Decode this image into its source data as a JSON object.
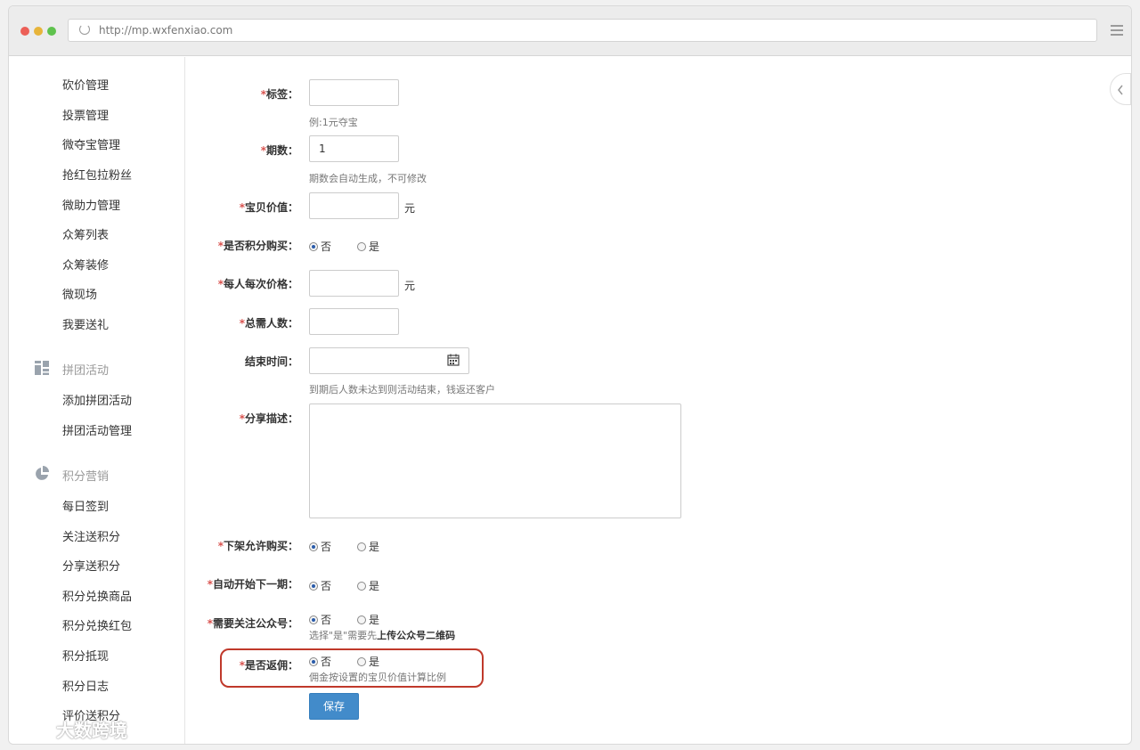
{
  "browser": {
    "url": "http://mp.wxfenxiao.com",
    "colors": {
      "red": "#ec5f57",
      "yellow": "#e7b43a",
      "green": "#5fc24d"
    }
  },
  "sidebar": {
    "items_top": [
      "砍价管理",
      "投票管理",
      "微夺宝管理",
      "抢红包拉粉丝",
      "微助力管理",
      "众筹列表",
      "众筹装修",
      "微现场",
      "我要送礼"
    ],
    "group_pintuan": {
      "label": "拼团活动",
      "icon": "grid-icon",
      "items": [
        "添加拼团活动",
        "拼团活动管理"
      ]
    },
    "group_points": {
      "label": "积分营销",
      "icon": "pie-chart-icon",
      "items": [
        "每日签到",
        "关注送积分",
        "分享送积分",
        "积分兑换商品",
        "积分兑换红包",
        "积分抵现",
        "积分日志",
        "评价送积分"
      ]
    }
  },
  "form": {
    "tag": {
      "label": "标签：",
      "value": "",
      "hint": "例:1元夺宝"
    },
    "period": {
      "label": "期数：",
      "value": "1",
      "hint": "期数会自动生成，不可修改"
    },
    "item_value": {
      "label": "宝贝价值：",
      "value": "",
      "unit": "元"
    },
    "points_purchase": {
      "label": "是否积分购买：",
      "options": [
        "否",
        "是"
      ],
      "selected": "否"
    },
    "price_per": {
      "label": "每人每次价格：",
      "value": "",
      "unit": "元"
    },
    "total_people": {
      "label": "总需人数：",
      "value": ""
    },
    "end_time": {
      "label": "结束时间：",
      "value": "",
      "hint": "到期后人数未达到则活动结束，钱返还客户"
    },
    "share_desc": {
      "label": "分享描述：",
      "value": ""
    },
    "allow_after_offshelf": {
      "label": "下架允许购买：",
      "options": [
        "否",
        "是"
      ],
      "selected": "否"
    },
    "auto_next": {
      "label": "自动开始下一期：",
      "options": [
        "否",
        "是"
      ],
      "selected": "否"
    },
    "follow_required": {
      "label": "需要关注公众号：",
      "options": [
        "否",
        "是"
      ],
      "selected": "否",
      "hint_prefix": "选择\"是\"需要先",
      "hint_bold": "上传公众号二维码"
    },
    "commission": {
      "label": "是否返佣：",
      "options": [
        "否",
        "是"
      ],
      "selected": "否",
      "hint": "佣金按设置的宝贝价值计算比例"
    },
    "required_mark": "*",
    "save_label": "保存"
  },
  "watermark": "大数跨境"
}
